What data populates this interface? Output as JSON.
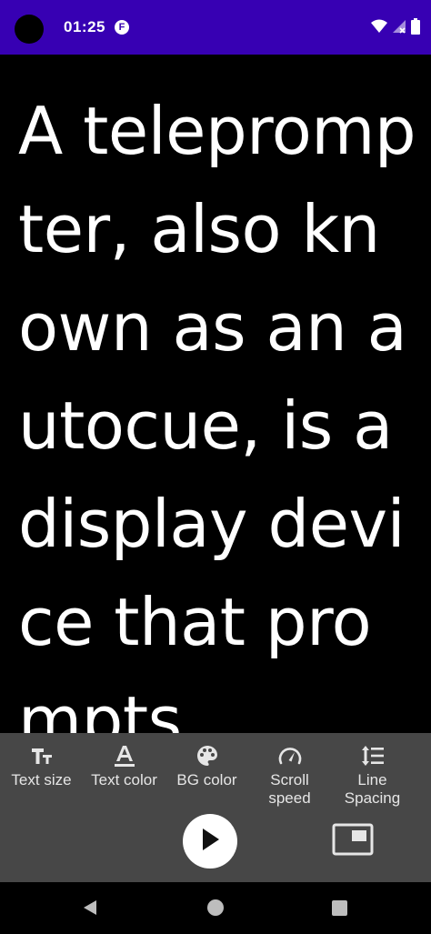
{
  "status_bar": {
    "time": "01:25",
    "notification_icon": "F",
    "icons": [
      "wifi-icon",
      "signal-icon",
      "battery-icon"
    ],
    "color": "#3700b3"
  },
  "prompter": {
    "text": "A teleprompter, also known as an autocue, is a display device that prompts",
    "text_color": "#ffffff",
    "background_color": "#000000"
  },
  "controls": {
    "background_color": "#474747",
    "buttons": [
      {
        "icon": "text-size-icon",
        "label": "Text size"
      },
      {
        "icon": "text-color-icon",
        "label": "Text color"
      },
      {
        "icon": "palette-icon",
        "label": "BG color"
      },
      {
        "icon": "speedometer-icon",
        "label": "Scroll speed"
      },
      {
        "icon": "line-spacing-icon",
        "label": "Line Spacing"
      }
    ],
    "play_icon": "play-icon",
    "pip_icon": "picture-in-picture-icon"
  },
  "nav_bar": {
    "icons": [
      "back-icon",
      "home-icon",
      "recents-icon"
    ]
  }
}
